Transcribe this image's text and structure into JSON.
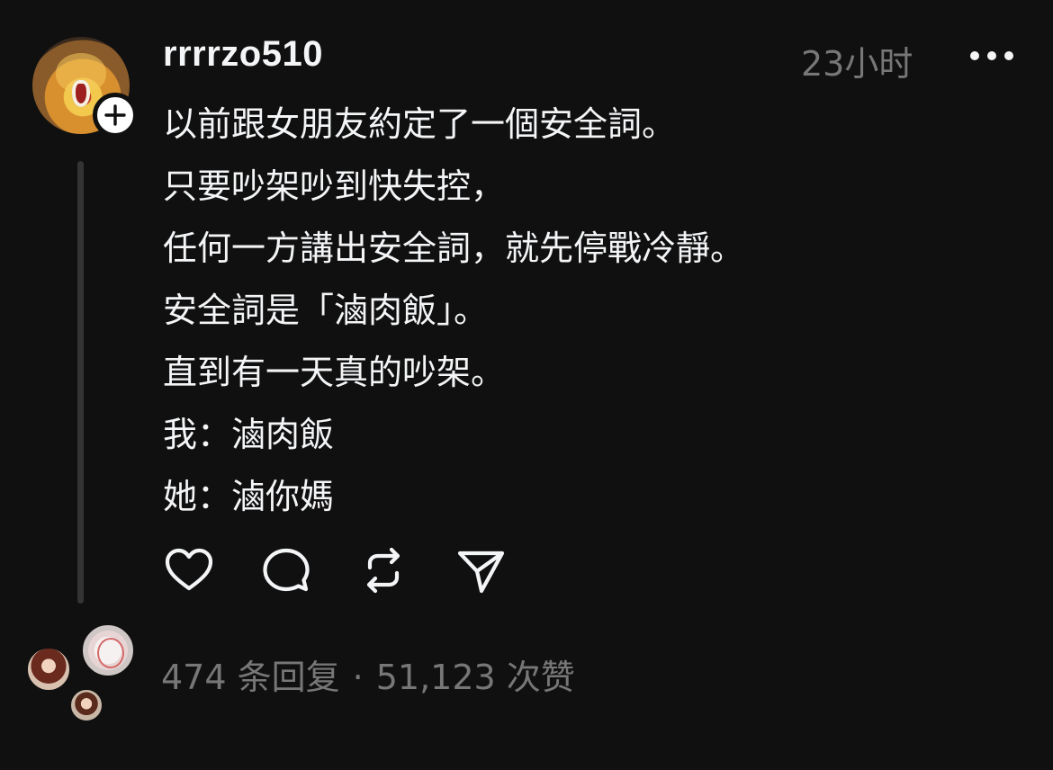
{
  "post": {
    "username": "rrrrzo510",
    "timestamp": "23小时",
    "body_lines": [
      "以前跟女朋友約定了一個安全詞。",
      "只要吵架吵到快失控，",
      "任何一方講出安全詞，就先停戰冷靜。",
      "安全詞是「滷肉飯」。",
      "直到有一天真的吵架。",
      "我：滷肉飯",
      "她：滷你媽"
    ],
    "icons": {
      "follow": "plus-icon",
      "more": "more-horizontal-icon",
      "like": "heart-icon",
      "comment": "comment-bubble-icon",
      "repost": "repost-icon",
      "share": "send-icon"
    }
  },
  "stats": {
    "replies": "474 条回复",
    "separator": "·",
    "likes": "51,123 次赞"
  },
  "colors": {
    "background": "#101010",
    "text": "#f3f5f7",
    "muted": "#777777",
    "thread_line": "#343434"
  }
}
